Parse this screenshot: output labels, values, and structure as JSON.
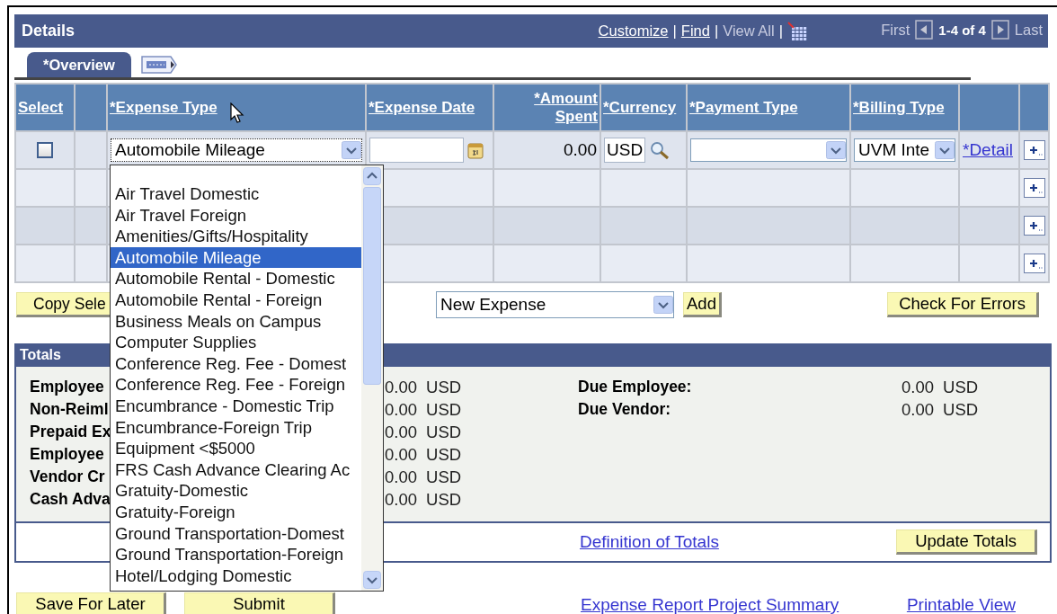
{
  "details": {
    "title": "Details",
    "toolbar": [
      {
        "kind": "link",
        "label": "Customize"
      },
      {
        "kind": "separator",
        "label": "|"
      },
      {
        "kind": "link",
        "label": "Find"
      },
      {
        "kind": "separator",
        "label": "|"
      },
      {
        "kind": "disabled-link",
        "label": "View All"
      },
      {
        "kind": "separator",
        "label": "|"
      },
      {
        "kind": "grid-icon"
      }
    ],
    "nav": {
      "first": "First",
      "range": "1-4 of 4",
      "last": "Last",
      "first_disabled": true,
      "last_disabled": true
    },
    "tabs": [
      {
        "label": "*Overview",
        "selected": true
      }
    ],
    "columns": [
      {
        "kind": "text",
        "label": "Select"
      },
      {
        "kind": "blank"
      },
      {
        "kind": "text",
        "label": "*Expense Type"
      },
      {
        "kind": "text",
        "label": "*Expense Date"
      },
      {
        "kind": "right",
        "label": "*Amount Spent"
      },
      {
        "kind": "text",
        "label": "*Currency"
      },
      {
        "kind": "text",
        "label": "*Payment Type"
      },
      {
        "kind": "text",
        "label": "*Billing Type"
      },
      {
        "kind": "blank"
      },
      {
        "kind": "blank"
      }
    ],
    "rows": [
      {
        "kind": "entry",
        "checked": false,
        "expense_type": {
          "value": "Automobile Mileage",
          "expanded": true,
          "options": [
            {
              "label": "Air Travel Domestic",
              "selected": false
            },
            {
              "label": "Air Travel Foreign",
              "selected": false
            },
            {
              "label": "Amenities/Gifts/Hospitality",
              "selected": false
            },
            {
              "label": "Automobile Mileage",
              "selected": true
            },
            {
              "label": "Automobile Rental - Domestic",
              "selected": false
            },
            {
              "label": "Automobile Rental - Foreign",
              "selected": false
            },
            {
              "label": "Business Meals on Campus",
              "selected": false
            },
            {
              "label": "Computer Supplies",
              "selected": false
            },
            {
              "label": "Conference Reg. Fee - Domest",
              "selected": false
            },
            {
              "label": "Conference Reg. Fee - Foreign",
              "selected": false
            },
            {
              "label": "Encumbrance - Domestic Trip",
              "selected": false
            },
            {
              "label": "Encumbrance-Foreign Trip",
              "selected": false
            },
            {
              "label": "Equipment <$5000",
              "selected": false
            },
            {
              "label": "FRS Cash Advance Clearing Ac",
              "selected": false
            },
            {
              "label": "Gratuity-Domestic",
              "selected": false
            },
            {
              "label": "Gratuity-Foreign",
              "selected": false
            },
            {
              "label": "Ground Transportation-Domest",
              "selected": false
            },
            {
              "label": "Ground Transportation-Foreign",
              "selected": false
            },
            {
              "label": "Hotel/Lodging Domestic",
              "selected": false
            }
          ]
        },
        "amount": "0.00",
        "currency": "USD",
        "billing_type": "UVM Inte",
        "detail": "*Detail"
      },
      {
        "kind": "blank"
      },
      {
        "kind": "blank"
      },
      {
        "kind": "blank"
      }
    ]
  },
  "actions": {
    "copy_button": "Copy Sele",
    "new_select": "New Expense",
    "add_button": "Add",
    "check_button": "Check For Errors"
  },
  "totals": {
    "title": "Totals",
    "left": [
      {
        "label": "Employee",
        "amount": "0.00",
        "currency": "USD"
      },
      {
        "label": "Non-Reiml",
        "amount": "0.00",
        "currency": "USD"
      },
      {
        "label": "Prepaid Ex",
        "amount": "0.00",
        "currency": "USD"
      },
      {
        "label": "Employee",
        "amount": "0.00",
        "currency": "USD"
      },
      {
        "label": "Vendor Cr",
        "amount": "0.00",
        "currency": "USD"
      },
      {
        "label": "Cash Adva",
        "amount": "0.00",
        "currency": "USD"
      }
    ],
    "right": [
      {
        "label": "Due Employee:",
        "amount": "0.00",
        "currency": "USD"
      },
      {
        "label": "Due Vendor:",
        "amount": "0.00",
        "currency": "USD"
      }
    ],
    "link": "Definition of Totals",
    "button": "Update Totals"
  },
  "footer": {
    "buttons": [
      "Save For Later",
      "Submit"
    ],
    "links": [
      "Expense Report Project Summary",
      "Printable View"
    ]
  }
}
